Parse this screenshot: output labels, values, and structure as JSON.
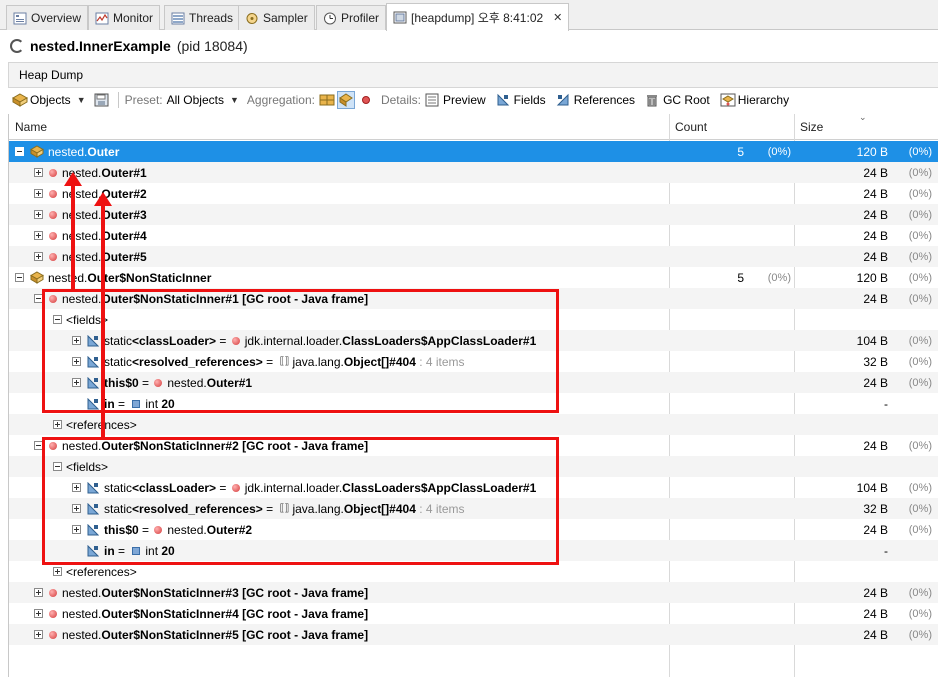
{
  "tabs": [
    {
      "label": "Overview",
      "icon": "overview-icon"
    },
    {
      "label": "Monitor",
      "icon": "monitor-icon"
    },
    {
      "label": "Threads",
      "icon": "threads-icon"
    },
    {
      "label": "Sampler",
      "icon": "sampler-icon"
    },
    {
      "label": "Profiler",
      "icon": "profiler-icon"
    },
    {
      "label": "[heapdump] 오후 8:41:02",
      "icon": "heapdump-icon",
      "close": "✕"
    }
  ],
  "header": {
    "class_name": "nested.InnerExample",
    "pid": "(pid 18084)"
  },
  "subbar": {
    "label": "Heap Dump"
  },
  "toolbar": {
    "objects": "Objects",
    "preset_label": "Preset:",
    "preset_value": "All Objects",
    "aggregation_label": "Aggregation:",
    "details_label": "Details:",
    "preview": "Preview",
    "fields": "Fields",
    "references": "References",
    "gc_root": "GC Root",
    "hierarchy": "Hierarchy"
  },
  "columns": {
    "name": "Name",
    "count": "Count",
    "size": "Size"
  },
  "rows": [
    {
      "indent": 0,
      "exp": "minus",
      "icon": "class",
      "pre": "nested.",
      "bold": "Outer",
      "rest": "",
      "count": "5",
      "countp": "(0%)",
      "size": "120 B",
      "sizep": "(0%)",
      "selected": true
    },
    {
      "indent": 1,
      "exp": "plus",
      "icon": "dot",
      "pre": "nested.",
      "bold": "Outer#1",
      "rest": "",
      "count": "",
      "countp": "",
      "size": "24 B",
      "sizep": "(0%)"
    },
    {
      "indent": 1,
      "exp": "plus",
      "icon": "dot",
      "pre": "nested.",
      "bold": "Outer#2",
      "rest": "",
      "count": "",
      "countp": "",
      "size": "24 B",
      "sizep": "(0%)"
    },
    {
      "indent": 1,
      "exp": "plus",
      "icon": "dot",
      "pre": "nested.",
      "bold": "Outer#3",
      "rest": "",
      "count": "",
      "countp": "",
      "size": "24 B",
      "sizep": "(0%)"
    },
    {
      "indent": 1,
      "exp": "plus",
      "icon": "dot",
      "pre": "nested.",
      "bold": "Outer#4",
      "rest": "",
      "count": "",
      "countp": "",
      "size": "24 B",
      "sizep": "(0%)"
    },
    {
      "indent": 1,
      "exp": "plus",
      "icon": "dot",
      "pre": "nested.",
      "bold": "Outer#5",
      "rest": "",
      "count": "",
      "countp": "",
      "size": "24 B",
      "sizep": "(0%)"
    },
    {
      "indent": 0,
      "exp": "minus",
      "icon": "class",
      "pre": "nested.",
      "bold": "Outer$NonStaticInner",
      "rest": "",
      "count": "5",
      "countp": "(0%)",
      "size": "120 B",
      "sizep": "(0%)"
    },
    {
      "indent": 1,
      "exp": "minus",
      "icon": "dot",
      "pre": "nested.",
      "bold": "Outer$NonStaticInner#1 [GC root - Java frame]",
      "rest": "",
      "count": "",
      "countp": "",
      "size": "24 B",
      "sizep": "(0%)"
    },
    {
      "indent": 2,
      "exp": "minus",
      "icon": "none",
      "pre": "<fields>",
      "bold": "",
      "rest": "",
      "count": "",
      "countp": "",
      "size": "",
      "sizep": ""
    },
    {
      "indent": 3,
      "exp": "plus",
      "icon": "field",
      "pre": "static ",
      "bold": "<classLoader>",
      "rest": " = ",
      "ref": "dot",
      "pre2": "jdk.internal.loader.",
      "bold2": "ClassLoaders$AppClassLoader#1",
      "extra": "",
      "count": "",
      "countp": "",
      "size": "104 B",
      "sizep": "(0%)"
    },
    {
      "indent": 3,
      "exp": "plus",
      "icon": "field",
      "pre": "static ",
      "bold": "<resolved_references>",
      "rest": " = ",
      "ref": "array",
      "pre2": "java.lang.",
      "bold2": "Object[]#404",
      "extra": " : 4 items",
      "count": "",
      "countp": "",
      "size": "32 B",
      "sizep": "(0%)"
    },
    {
      "indent": 3,
      "exp": "plus",
      "icon": "field",
      "pre": "",
      "bold": "this$0",
      "rest": " = ",
      "ref": "dot",
      "pre2": "nested.",
      "bold2": "Outer#1",
      "extra": "",
      "count": "",
      "countp": "",
      "size": "24 B",
      "sizep": "(0%)"
    },
    {
      "indent": 3,
      "exp": "none",
      "icon": "field",
      "pre": "",
      "bold": "in",
      "rest": " = ",
      "ref": "prim",
      "pre2": "int ",
      "bold2": "20",
      "extra": "",
      "count": "",
      "countp": "",
      "size": "-",
      "sizep": ""
    },
    {
      "indent": 2,
      "exp": "plus",
      "icon": "none",
      "pre": "<references>",
      "bold": "",
      "rest": "",
      "count": "",
      "countp": "",
      "size": "",
      "sizep": ""
    },
    {
      "indent": 1,
      "exp": "minus",
      "icon": "dot",
      "pre": "nested.",
      "bold": "Outer$NonStaticInner#2 [GC root - Java frame]",
      "rest": "",
      "count": "",
      "countp": "",
      "size": "24 B",
      "sizep": "(0%)"
    },
    {
      "indent": 2,
      "exp": "minus",
      "icon": "none",
      "pre": "<fields>",
      "bold": "",
      "rest": "",
      "count": "",
      "countp": "",
      "size": "",
      "sizep": ""
    },
    {
      "indent": 3,
      "exp": "plus",
      "icon": "field",
      "pre": "static ",
      "bold": "<classLoader>",
      "rest": " = ",
      "ref": "dot",
      "pre2": "jdk.internal.loader.",
      "bold2": "ClassLoaders$AppClassLoader#1",
      "extra": "",
      "count": "",
      "countp": "",
      "size": "104 B",
      "sizep": "(0%)"
    },
    {
      "indent": 3,
      "exp": "plus",
      "icon": "field",
      "pre": "static ",
      "bold": "<resolved_references>",
      "rest": " = ",
      "ref": "array",
      "pre2": "java.lang.",
      "bold2": "Object[]#404",
      "extra": " : 4 items",
      "count": "",
      "countp": "",
      "size": "32 B",
      "sizep": "(0%)"
    },
    {
      "indent": 3,
      "exp": "plus",
      "icon": "field",
      "pre": "",
      "bold": "this$0",
      "rest": " = ",
      "ref": "dot",
      "pre2": "nested.",
      "bold2": "Outer#2",
      "extra": "",
      "count": "",
      "countp": "",
      "size": "24 B",
      "sizep": "(0%)"
    },
    {
      "indent": 3,
      "exp": "none",
      "icon": "field",
      "pre": "",
      "bold": "in",
      "rest": " = ",
      "ref": "prim",
      "pre2": "int ",
      "bold2": "20",
      "extra": "",
      "count": "",
      "countp": "",
      "size": "-",
      "sizep": ""
    },
    {
      "indent": 2,
      "exp": "plus",
      "icon": "none",
      "pre": "<references>",
      "bold": "",
      "rest": "",
      "count": "",
      "countp": "",
      "size": "",
      "sizep": ""
    },
    {
      "indent": 1,
      "exp": "plus",
      "icon": "dot",
      "pre": "nested.",
      "bold": "Outer$NonStaticInner#3 [GC root - Java frame]",
      "rest": "",
      "count": "",
      "countp": "",
      "size": "24 B",
      "sizep": "(0%)"
    },
    {
      "indent": 1,
      "exp": "plus",
      "icon": "dot",
      "pre": "nested.",
      "bold": "Outer$NonStaticInner#4 [GC root - Java frame]",
      "rest": "",
      "count": "",
      "countp": "",
      "size": "24 B",
      "sizep": "(0%)"
    },
    {
      "indent": 1,
      "exp": "plus",
      "icon": "dot",
      "pre": "nested.",
      "bold": "Outer$NonStaticInner#5 [GC root - Java frame]",
      "rest": "",
      "count": "",
      "countp": "",
      "size": "24 B",
      "sizep": "(0%)"
    }
  ],
  "colors": {
    "selection": "#1e90e6",
    "annotation": "#ee1111"
  }
}
